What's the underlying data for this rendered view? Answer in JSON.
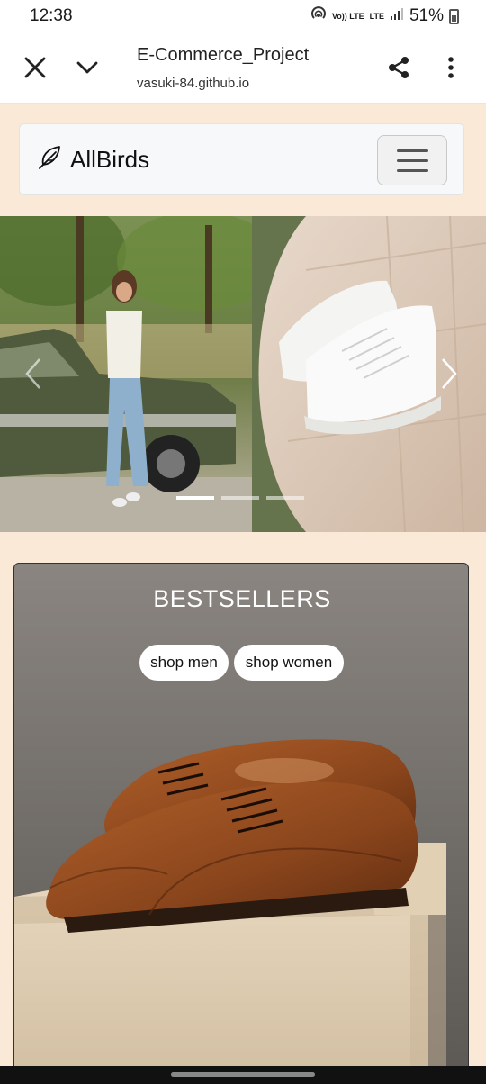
{
  "status": {
    "time": "12:38",
    "volte": "Vo)) LTE",
    "lte": "LTE",
    "battery": "51%"
  },
  "browser": {
    "page_title": "E-Commerce_Project",
    "url": "vasuki-84.github.io",
    "icons": [
      "close-icon",
      "chevron-down-icon",
      "share-icon",
      "more-vert-icon"
    ]
  },
  "nav": {
    "brand": "AllBirds",
    "brand_icon": "feather-icon",
    "menu_icon": "hamburger-icon"
  },
  "carousel": {
    "slides": [
      "woman-by-green-car",
      "white-sneakers"
    ],
    "active_index": 0,
    "indicator_count": 3
  },
  "bestsellers": {
    "title": "BESTSELLERS",
    "shop_men": "shop men",
    "shop_women": "shop women",
    "image": "brown-oxford-shoes"
  },
  "colors": {
    "page_bg": "#fbe9d7",
    "nav_bg": "#f7f8fa",
    "button_bg": "#ffffff"
  }
}
